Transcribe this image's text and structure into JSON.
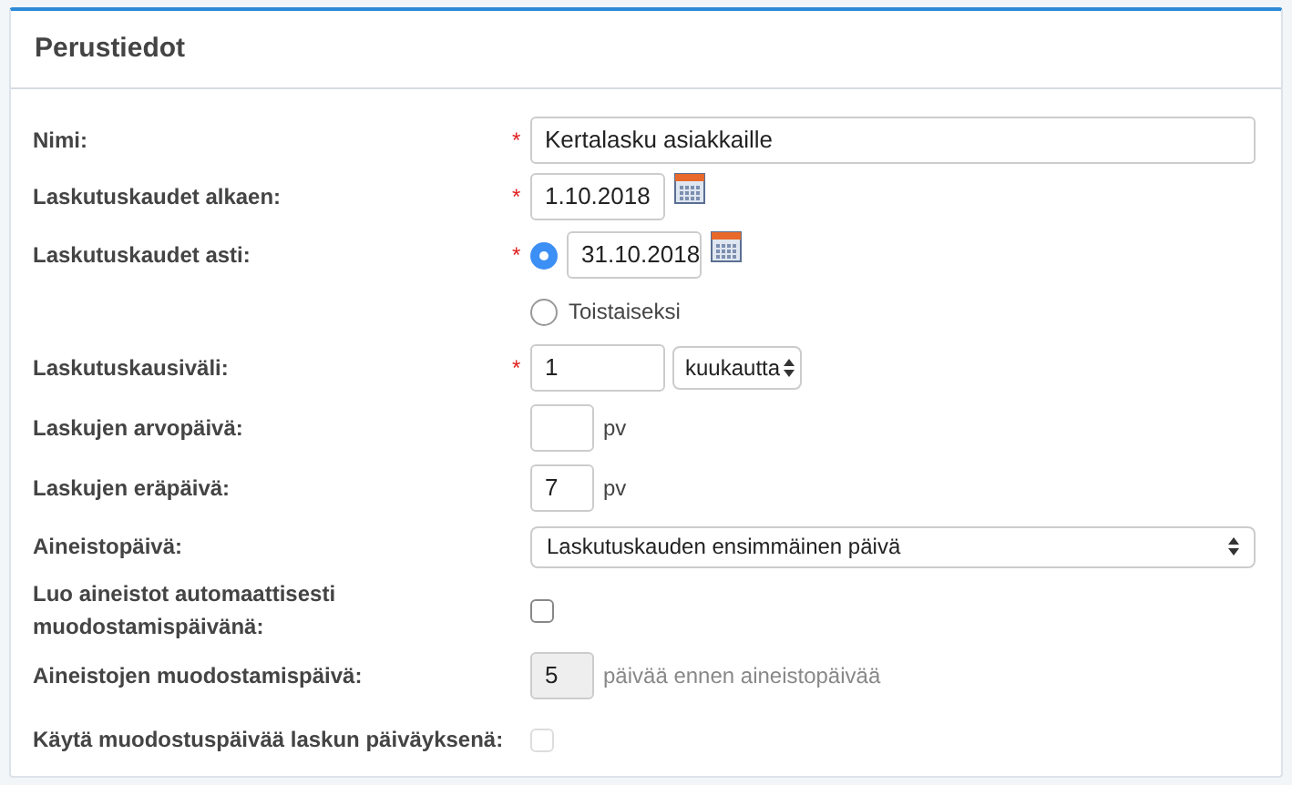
{
  "panel": {
    "title": "Perustiedot"
  },
  "rows": [
    {
      "kind": "text",
      "label": "Nimi:",
      "required_mark": "*",
      "value": "Kertalasku asiakkaille"
    },
    {
      "kind": "date",
      "label": "Laskutuskaudet alkaen:",
      "required_mark": "*",
      "value": "1.10.2018"
    },
    {
      "kind": "date",
      "label": "Laskutuskaudet asti:",
      "required_mark": "*",
      "value": "31.10.2018",
      "radio": {
        "selected": true
      }
    },
    {
      "kind": "radio",
      "option": "Toistaiseksi",
      "selected": false
    },
    {
      "kind": "interval",
      "label": "Laskutuskausiväli:",
      "required_mark": "*",
      "value": "1",
      "unit": "kuukautta"
    },
    {
      "kind": "days",
      "label": "Laskujen arvopäivä:",
      "suffix": "pv",
      "disabled": false
    },
    {
      "kind": "days",
      "label": "Laskujen eräpäivä:",
      "value": "7",
      "suffix": "pv",
      "disabled": false
    },
    {
      "kind": "select",
      "label": "Aineistopäivä:",
      "value": "Laskutuskauden ensimmäinen päivä"
    },
    {
      "kind": "checkbox",
      "label": "Luo aineistot automaattisesti muodostamispäivänä:",
      "checked": false,
      "disabled": false
    },
    {
      "kind": "days",
      "label": "Aineistojen muodostamispäivä:",
      "value": "5",
      "suffix": "päivää ennen aineistopäivää",
      "disabled": true
    },
    {
      "kind": "checkbox",
      "label": "Käytä muodostuspäivää laskun päiväyksenä:",
      "checked": false,
      "disabled": true
    }
  ]
}
